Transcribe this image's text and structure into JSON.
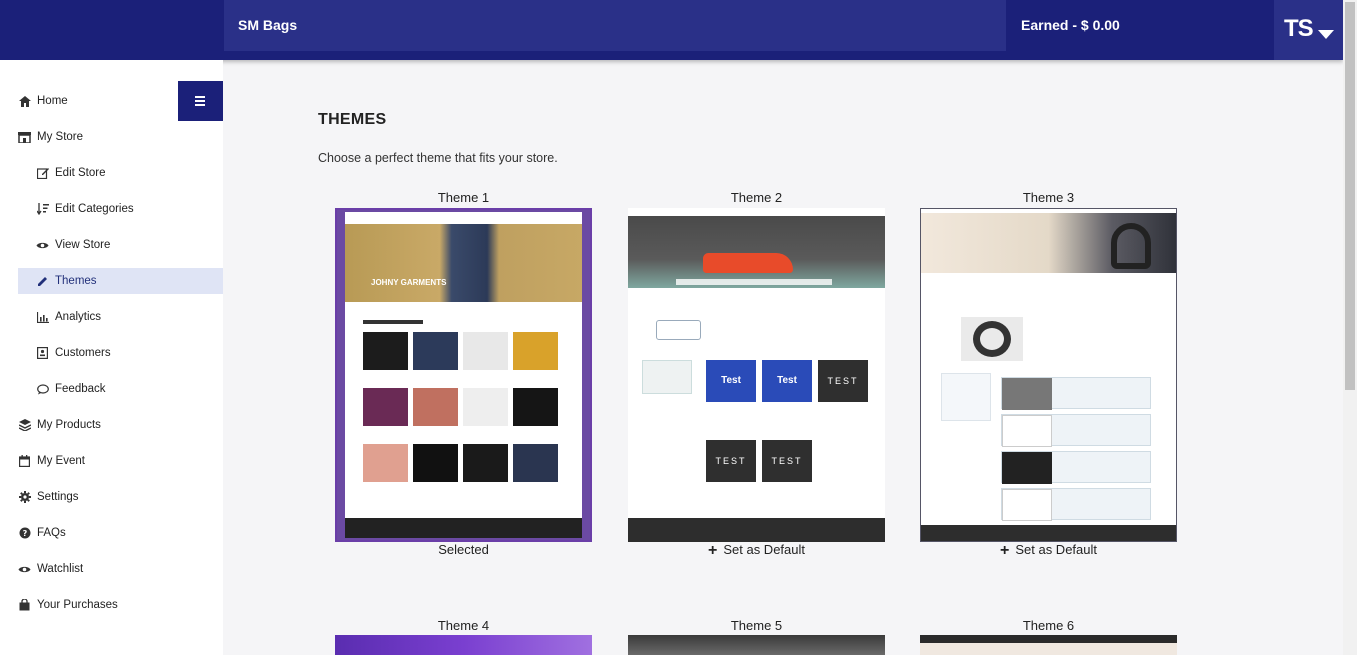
{
  "header": {
    "store_name": "SM Bags",
    "earned": "Earned - $ 0.00",
    "user_initials": "TS"
  },
  "sidebar": {
    "items": [
      {
        "label": "Home",
        "icon": "home-icon"
      },
      {
        "label": "My Store",
        "icon": "store-icon"
      },
      {
        "label": "Edit Store",
        "icon": "edit-icon"
      },
      {
        "label": "Edit Categories",
        "icon": "sort-icon"
      },
      {
        "label": "View Store",
        "icon": "eye-icon"
      },
      {
        "label": "Themes",
        "icon": "pencil-icon"
      },
      {
        "label": "Analytics",
        "icon": "chart-icon"
      },
      {
        "label": "Customers",
        "icon": "id-card-icon"
      },
      {
        "label": "Feedback",
        "icon": "comment-icon"
      },
      {
        "label": "My Products",
        "icon": "layers-icon"
      },
      {
        "label": "My Event",
        "icon": "calendar-icon"
      },
      {
        "label": "Settings",
        "icon": "gear-icon"
      },
      {
        "label": "FAQs",
        "icon": "question-icon"
      },
      {
        "label": "Watchlist",
        "icon": "eye-icon"
      },
      {
        "label": "Your Purchases",
        "icon": "bag-icon"
      }
    ]
  },
  "main": {
    "heading": "THEMES",
    "subtext": "Choose a perfect theme that fits your store.",
    "themes": [
      {
        "title": "Theme 1",
        "status": "Selected"
      },
      {
        "title": "Theme 2",
        "status": "Set as Default"
      },
      {
        "title": "Theme 3",
        "status": "Set as Default"
      },
      {
        "title": "Theme 4"
      },
      {
        "title": "Theme 5"
      },
      {
        "title": "Theme 6"
      }
    ]
  },
  "previews": {
    "t1_brand": "JOHNY GARMENTS",
    "t2_tile": "TEST",
    "t2_blue": "Test"
  },
  "colors": {
    "primary": "#1b2079",
    "selected_border": "#6a3ea8",
    "active_bg": "#dfe4f5"
  }
}
